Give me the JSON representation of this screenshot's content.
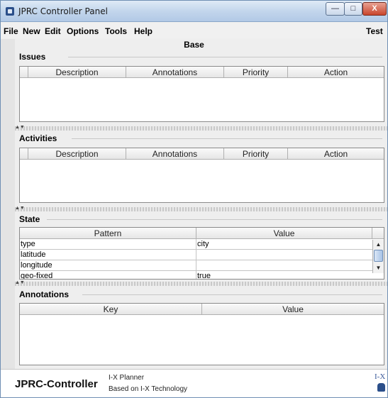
{
  "window": {
    "title": "JPRC Controller Panel"
  },
  "titlebar": {
    "minimize_glyph": "—",
    "maximize_glyph": "□",
    "close_glyph": "X"
  },
  "menu": {
    "items": [
      "File",
      "New",
      "Edit",
      "Options",
      "Tools",
      "Help"
    ],
    "right_item": "Test"
  },
  "base_label": "Base",
  "issues": {
    "title": "Issues",
    "columns": [
      "Description",
      "Annotations",
      "Priority",
      "Action"
    ]
  },
  "activities": {
    "title": "Activities",
    "columns": [
      "Description",
      "Annotations",
      "Priority",
      "Action"
    ]
  },
  "state": {
    "title": "State",
    "columns": [
      "Pattern",
      "Value"
    ],
    "rows": [
      {
        "pattern": "type",
        "value": "city"
      },
      {
        "pattern": "latitude",
        "value": ""
      },
      {
        "pattern": "longitude",
        "value": ""
      },
      {
        "pattern": "geo-fixed",
        "value": "true"
      }
    ]
  },
  "annotations": {
    "title": "Annotations",
    "columns": [
      "Key",
      "Value"
    ]
  },
  "footer": {
    "app_name": "JPRC-Controller",
    "planner": "I-X Planner",
    "based_on": "Based on I-X Technology",
    "logo_text": "I-X"
  },
  "colors": {
    "titlebar": "#c3d6ec",
    "close_button": "#c9452c",
    "scroll_thumb": "#a8c3e6"
  }
}
